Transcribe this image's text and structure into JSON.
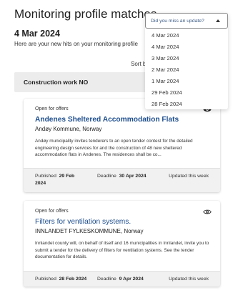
{
  "page": {
    "title": "Monitoring profile matches",
    "date_heading": "4 Mar 2024",
    "subtitle": "Here are your new hits on your monitoring profile",
    "sort_label": "Sort b"
  },
  "dropdown": {
    "placeholder": "Did you miss an update?",
    "options": [
      "4 Mar 2024",
      "4 Mar 2024",
      "3 Mar 2024",
      "2 Mar 2024",
      "1 Mar 2024",
      "29 Feb 2024",
      "28 Feb 2024"
    ]
  },
  "group": {
    "title": "Construction work NO"
  },
  "cards": [
    {
      "status": "Open for offers",
      "title": "Andenes Sheltered Accommodation Flats",
      "buyer": "Andøy Kommune, Norway",
      "description": "Andøy municipality invites tenderers to an open tender contest for the detailed engineering design services for and the construction of 48 new sheltered accommodation flats in Andenes. The residences shall be co...",
      "published_label": "Published",
      "published_value": "29 Feb 2024",
      "deadline_label": "Deadline",
      "deadline_value": "30 Apr 2024",
      "updated": "Updated this week",
      "eye_icon": "eye-icon"
    },
    {
      "status": "Open for offers",
      "title": "Filters for ventilation systems.",
      "buyer": "INNLANDET FYLKESKOMMUNE, Norway",
      "description": "Innlandet county will, on behalf of itself and 16 municipalities in Innlandet, invite you to submit a tender for the delivery of filters for ventilation systems. See the tender documentation for details.",
      "published_label": "Published",
      "published_value": "28 Feb 2024",
      "deadline_label": "Deadline",
      "deadline_value": "9 Apr 2024",
      "updated": "Updated this week",
      "eye_icon": "eye-outline-icon"
    }
  ],
  "colors": {
    "title_link": "#1f4f8f",
    "group_header_bg": "#ececec",
    "card_footer_bg": "#f1f1f1"
  }
}
